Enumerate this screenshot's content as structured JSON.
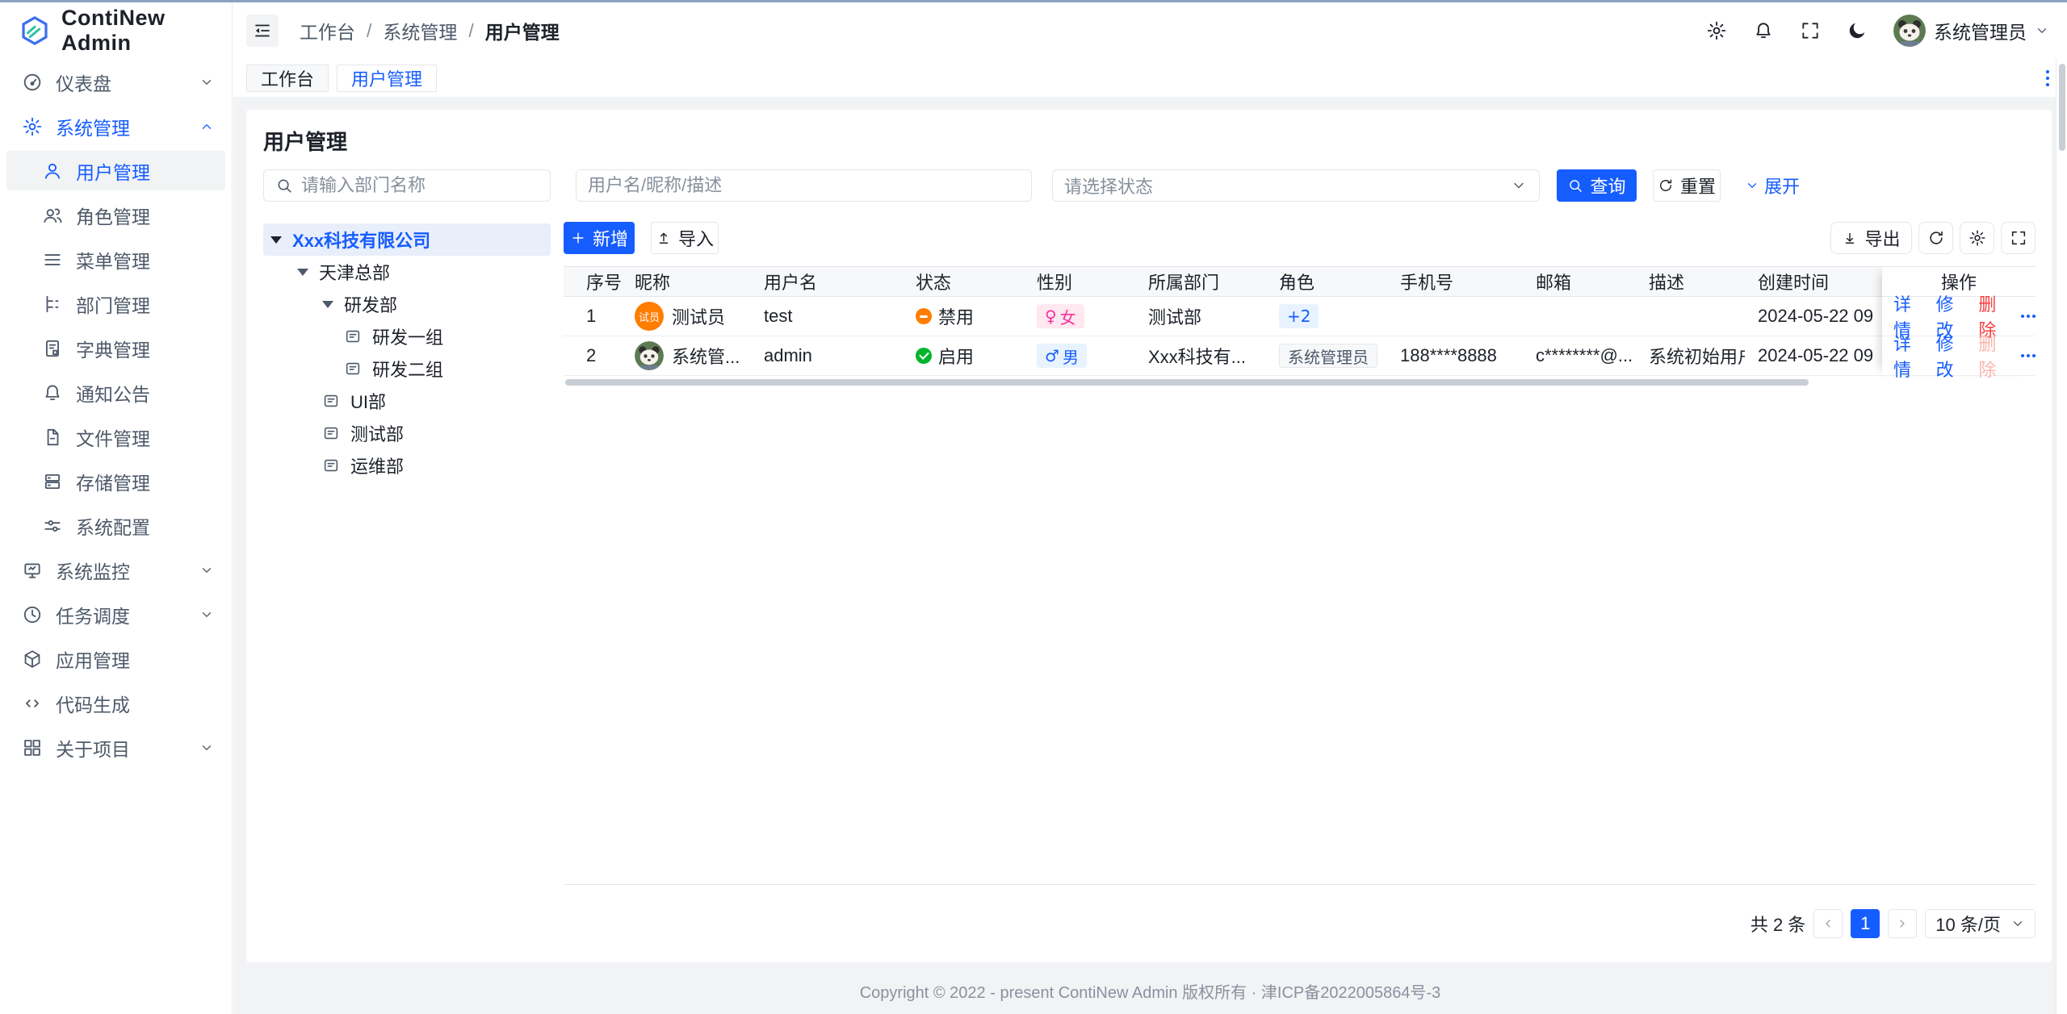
{
  "app": {
    "title": "ContiNew Admin"
  },
  "colors": {
    "primary": "#165dff",
    "success": "#00b42a",
    "warning": "#ff7d00",
    "danger": "#f53f3f",
    "female": "#f5319d"
  },
  "sidebar": {
    "items": [
      {
        "label": "仪表盘",
        "icon": "gauge-icon"
      },
      {
        "label": "系统管理",
        "icon": "gear-icon"
      },
      {
        "label": "用户管理",
        "icon": "user-icon"
      },
      {
        "label": "角色管理",
        "icon": "users-icon"
      },
      {
        "label": "菜单管理",
        "icon": "menu-lines-icon"
      },
      {
        "label": "部门管理",
        "icon": "tree-list-icon"
      },
      {
        "label": "字典管理",
        "icon": "dictionary-icon"
      },
      {
        "label": "通知公告",
        "icon": "bell-icon"
      },
      {
        "label": "文件管理",
        "icon": "file-icon"
      },
      {
        "label": "存储管理",
        "icon": "storage-icon"
      },
      {
        "label": "系统配置",
        "icon": "sliders-icon"
      },
      {
        "label": "系统监控",
        "icon": "monitor-icon"
      },
      {
        "label": "任务调度",
        "icon": "clock-icon"
      },
      {
        "label": "应用管理",
        "icon": "cube-icon"
      },
      {
        "label": "代码生成",
        "icon": "code-icon"
      },
      {
        "label": "关于项目",
        "icon": "grid-icon"
      }
    ]
  },
  "header": {
    "breadcrumb": {
      "a": "工作台",
      "b": "系统管理",
      "c": "用户管理"
    },
    "user_name": "系统管理员"
  },
  "tabs": {
    "t0": "工作台",
    "t1": "用户管理"
  },
  "page": {
    "title": "用户管理"
  },
  "filters": {
    "dept_placeholder": "请输入部门名称",
    "user_placeholder": "用户名/昵称/描述",
    "status_placeholder": "请选择状态",
    "search_label": "查询",
    "reset_label": "重置",
    "expand_label": "展开"
  },
  "tree": {
    "n0": "Xxx科技有限公司",
    "n1": "天津总部",
    "n2": "研发部",
    "n3": "研发一组",
    "n4": "研发二组",
    "n5": "UI部",
    "n6": "测试部",
    "n7": "运维部"
  },
  "toolbar": {
    "add_label": "新增",
    "import_label": "导入",
    "export_label": "导出"
  },
  "table": {
    "headers": [
      "序号",
      "昵称",
      "用户名",
      "状态",
      "性别",
      "所属部门",
      "角色",
      "手机号",
      "邮箱",
      "描述",
      "创建时间",
      "操作"
    ],
    "rows": [
      {
        "index": "1",
        "avatar_text": "试员",
        "nickname": "测试员",
        "username": "test",
        "status": "禁用",
        "gender_symbol": "♀",
        "gender": "女",
        "dept": "测试部",
        "role": "+2",
        "phone": "",
        "email": "",
        "desc": "",
        "created": "2024-05-22 09",
        "actions": {
          "detail": "详情",
          "edit": "修改",
          "delete": "删除"
        }
      },
      {
        "index": "2",
        "nickname": "系统管...",
        "username": "admin",
        "status": "启用",
        "gender_symbol": "♂",
        "gender": "男",
        "dept": "Xxx科技有...",
        "role": "系统管理员",
        "phone": "188****8888",
        "email": "c********@...",
        "desc": "系统初始用户",
        "created": "2024-05-22 09",
        "actions": {
          "detail": "详情",
          "edit": "修改",
          "delete": "删除"
        }
      }
    ]
  },
  "pagination": {
    "total_label": "共 2 条",
    "current_page": "1",
    "page_size": "10 条/页"
  },
  "footer": {
    "copyright": "Copyright © 2022 - present ContiNew Admin 版权所有 · 津ICP备2022005864号-3"
  }
}
